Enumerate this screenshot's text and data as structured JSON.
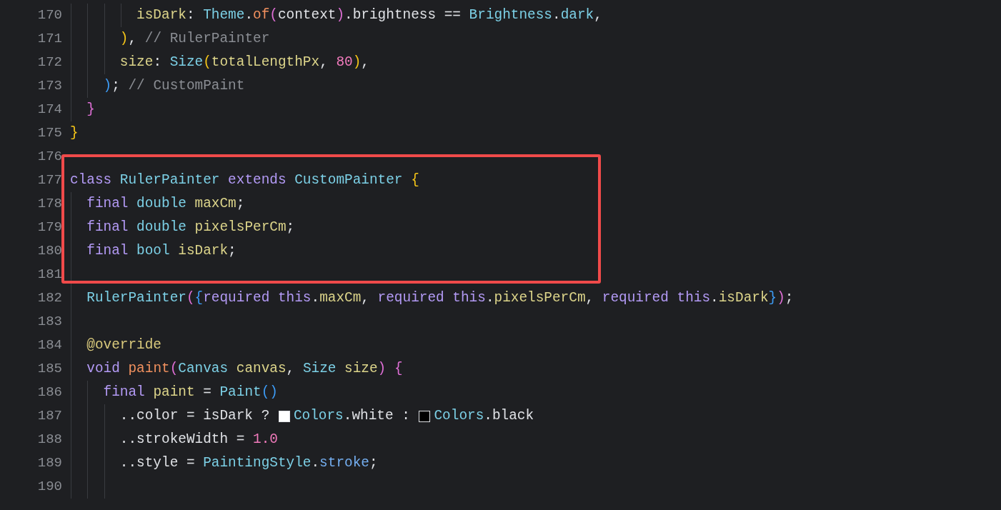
{
  "lines": [
    {
      "number": "170",
      "highlighted": false,
      "tokens": [
        {
          "text": "        isDark",
          "kind": "field"
        },
        {
          "text": ": ",
          "kind": "plain"
        },
        {
          "text": "Theme",
          "kind": "type"
        },
        {
          "text": ".",
          "kind": "plain"
        },
        {
          "text": "of",
          "kind": "method"
        },
        {
          "text": "(",
          "kind": "bracket2"
        },
        {
          "text": "context",
          "kind": "plain"
        },
        {
          "text": ")",
          "kind": "bracket2"
        },
        {
          "text": ".brightness == ",
          "kind": "plain"
        },
        {
          "text": "Brightness",
          "kind": "type"
        },
        {
          "text": ".",
          "kind": "plain"
        },
        {
          "text": "dark",
          "kind": "type"
        },
        {
          "text": ",",
          "kind": "plain"
        }
      ]
    },
    {
      "number": "171",
      "highlighted": false,
      "tokens": [
        {
          "text": "      )",
          "kind": "bracket1"
        },
        {
          "text": ", ",
          "kind": "plain"
        },
        {
          "text": "// RulerPainter",
          "kind": "comment"
        }
      ]
    },
    {
      "number": "172",
      "highlighted": false,
      "tokens": [
        {
          "text": "      size",
          "kind": "field"
        },
        {
          "text": ": ",
          "kind": "plain"
        },
        {
          "text": "Size",
          "kind": "type"
        },
        {
          "text": "(",
          "kind": "bracket1"
        },
        {
          "text": "totalLengthPx",
          "kind": "field"
        },
        {
          "text": ", ",
          "kind": "plain"
        },
        {
          "text": "80",
          "kind": "number"
        },
        {
          "text": ")",
          "kind": "bracket1"
        },
        {
          "text": ",",
          "kind": "plain"
        }
      ]
    },
    {
      "number": "173",
      "highlighted": false,
      "tokens": [
        {
          "text": "    )",
          "kind": "bracket3"
        },
        {
          "text": "; ",
          "kind": "plain"
        },
        {
          "text": "// CustomPaint",
          "kind": "comment"
        }
      ]
    },
    {
      "number": "174",
      "highlighted": false,
      "tokens": [
        {
          "text": "  }",
          "kind": "bracket2"
        }
      ]
    },
    {
      "number": "175",
      "highlighted": false,
      "tokens": [
        {
          "text": "}",
          "kind": "bracket1"
        }
      ]
    },
    {
      "number": "176",
      "highlighted": false
    },
    {
      "number": "177",
      "highlighted": true,
      "tokens": [
        {
          "text": "class ",
          "kind": "keyword"
        },
        {
          "text": "RulerPainter ",
          "kind": "type"
        },
        {
          "text": "extends ",
          "kind": "keyword"
        },
        {
          "text": "CustomPainter ",
          "kind": "type"
        },
        {
          "text": "{",
          "kind": "bracket1"
        }
      ]
    },
    {
      "number": "178",
      "highlighted": true,
      "tokens": [
        {
          "text": "  final ",
          "kind": "keyword"
        },
        {
          "text": "double ",
          "kind": "type"
        },
        {
          "text": "maxCm",
          "kind": "field"
        },
        {
          "text": ";",
          "kind": "plain"
        }
      ]
    },
    {
      "number": "179",
      "highlighted": true,
      "tokens": [
        {
          "text": "  final ",
          "kind": "keyword"
        },
        {
          "text": "double ",
          "kind": "type"
        },
        {
          "text": "pixelsPerCm",
          "kind": "field"
        },
        {
          "text": ";",
          "kind": "plain"
        }
      ]
    },
    {
      "number": "180",
      "highlighted": true,
      "tokens": [
        {
          "text": "  final ",
          "kind": "keyword"
        },
        {
          "text": "bool ",
          "kind": "type"
        },
        {
          "text": "isDark",
          "kind": "field"
        },
        {
          "text": ";",
          "kind": "plain"
        }
      ]
    },
    {
      "number": "181",
      "highlighted": true
    },
    {
      "number": "182",
      "highlighted": false,
      "tokens": [
        {
          "text": "  RulerPainter",
          "kind": "type"
        },
        {
          "text": "(",
          "kind": "bracket2"
        },
        {
          "text": "{",
          "kind": "bracket3"
        },
        {
          "text": "required this",
          "kind": "keyword"
        },
        {
          "text": ".",
          "kind": "plain"
        },
        {
          "text": "maxCm",
          "kind": "field"
        },
        {
          "text": ", ",
          "kind": "plain"
        },
        {
          "text": "required this",
          "kind": "keyword"
        },
        {
          "text": ".",
          "kind": "plain"
        },
        {
          "text": "pixelsPerCm",
          "kind": "field"
        },
        {
          "text": ", ",
          "kind": "plain"
        },
        {
          "text": "required this",
          "kind": "keyword"
        },
        {
          "text": ".",
          "kind": "plain"
        },
        {
          "text": "isDark",
          "kind": "field"
        },
        {
          "text": "}",
          "kind": "bracket3"
        },
        {
          "text": ")",
          "kind": "bracket2"
        },
        {
          "text": ";",
          "kind": "plain"
        }
      ]
    },
    {
      "number": "183",
      "highlighted": false
    },
    {
      "number": "184",
      "highlighted": false,
      "tokens": [
        {
          "text": "  @override",
          "kind": "annotation"
        }
      ]
    },
    {
      "number": "185",
      "highlighted": false,
      "tokens": [
        {
          "text": "  void ",
          "kind": "keyword"
        },
        {
          "text": "paint",
          "kind": "method"
        },
        {
          "text": "(",
          "kind": "bracket2"
        },
        {
          "text": "Canvas ",
          "kind": "type"
        },
        {
          "text": "canvas",
          "kind": "field"
        },
        {
          "text": ", ",
          "kind": "plain"
        },
        {
          "text": "Size ",
          "kind": "type"
        },
        {
          "text": "size",
          "kind": "field"
        },
        {
          "text": ") {",
          "kind": "bracket2"
        }
      ]
    },
    {
      "number": "186",
      "highlighted": false,
      "tokens": [
        {
          "text": "    final ",
          "kind": "keyword"
        },
        {
          "text": "paint",
          "kind": "field"
        },
        {
          "text": " = ",
          "kind": "plain"
        },
        {
          "text": "Paint",
          "kind": "type"
        },
        {
          "text": "()",
          "kind": "bracket3"
        }
      ]
    },
    {
      "number": "187",
      "highlighted": false,
      "tokens": [
        {
          "text": "      ..color = isDark ? ",
          "kind": "plain"
        },
        {
          "kind": "swatch",
          "color": "#ffffff"
        },
        {
          "text": "Colors",
          "kind": "type"
        },
        {
          "text": ".white : ",
          "kind": "plain"
        },
        {
          "kind": "swatch",
          "color": "#000000"
        },
        {
          "text": "Colors",
          "kind": "type"
        },
        {
          "text": ".black",
          "kind": "plain"
        }
      ]
    },
    {
      "number": "188",
      "highlighted": false,
      "tokens": [
        {
          "text": "      ..strokeWidth = ",
          "kind": "plain"
        },
        {
          "text": "1.0",
          "kind": "number"
        }
      ]
    },
    {
      "number": "189",
      "highlighted": false,
      "tokens": [
        {
          "text": "      ..style = ",
          "kind": "plain"
        },
        {
          "text": "PaintingStyle",
          "kind": "type"
        },
        {
          "text": ".",
          "kind": "plain"
        },
        {
          "text": "stroke",
          "kind": "constant"
        },
        {
          "text": ";",
          "kind": "plain"
        }
      ]
    },
    {
      "number": "190",
      "highlighted": false
    }
  ]
}
